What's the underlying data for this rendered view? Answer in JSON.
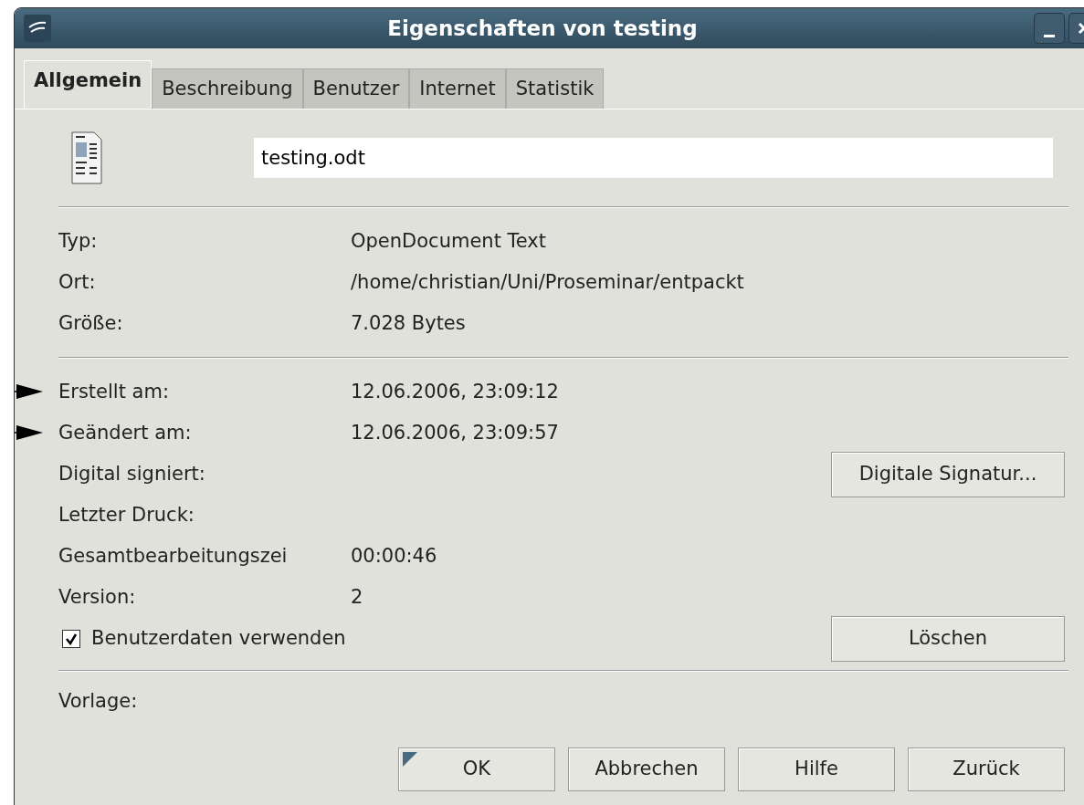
{
  "window": {
    "title": "Eigenschaften von testing"
  },
  "tabs": [
    {
      "label": "Allgemein",
      "selected": true
    },
    {
      "label": "Beschreibung",
      "selected": false
    },
    {
      "label": "Benutzer",
      "selected": false
    },
    {
      "label": "Internet",
      "selected": false
    },
    {
      "label": "Statistik",
      "selected": false
    }
  ],
  "file_name": {
    "value": "testing.odt"
  },
  "info": [
    {
      "label": "Typ:",
      "value": "OpenDocument Text"
    },
    {
      "label": "Ort:",
      "value": "/home/christian/Uni/Proseminar/entpackt"
    },
    {
      "label": "Größe:",
      "value": "7.028 Bytes"
    }
  ],
  "dates": [
    {
      "label": "Erstellt am:",
      "value": "12.06.2006, 23:09:12",
      "arrow": true
    },
    {
      "label": "Geändert am:",
      "value": "12.06.2006, 23:09:57",
      "arrow": true
    },
    {
      "label": "Digital signiert:",
      "button": "Digitale Signatur...",
      "arrow": false
    },
    {
      "label": "Letzter Druck:",
      "arrow": false
    },
    {
      "label": "Gesamtbearbeitungszei",
      "value": "00:00:46",
      "arrow": false
    },
    {
      "label": "Version:",
      "value": "2",
      "arrow": false
    }
  ],
  "user_data": {
    "label": "Benutzerdaten verwenden",
    "checked": true,
    "button": "Löschen"
  },
  "template": {
    "label": "Vorlage:"
  },
  "buttons": [
    {
      "label": "OK",
      "default": true
    },
    {
      "label": "Abbrechen",
      "default": false
    },
    {
      "label": "Hilfe",
      "default": false
    },
    {
      "label": "Zurück",
      "default": false
    }
  ]
}
